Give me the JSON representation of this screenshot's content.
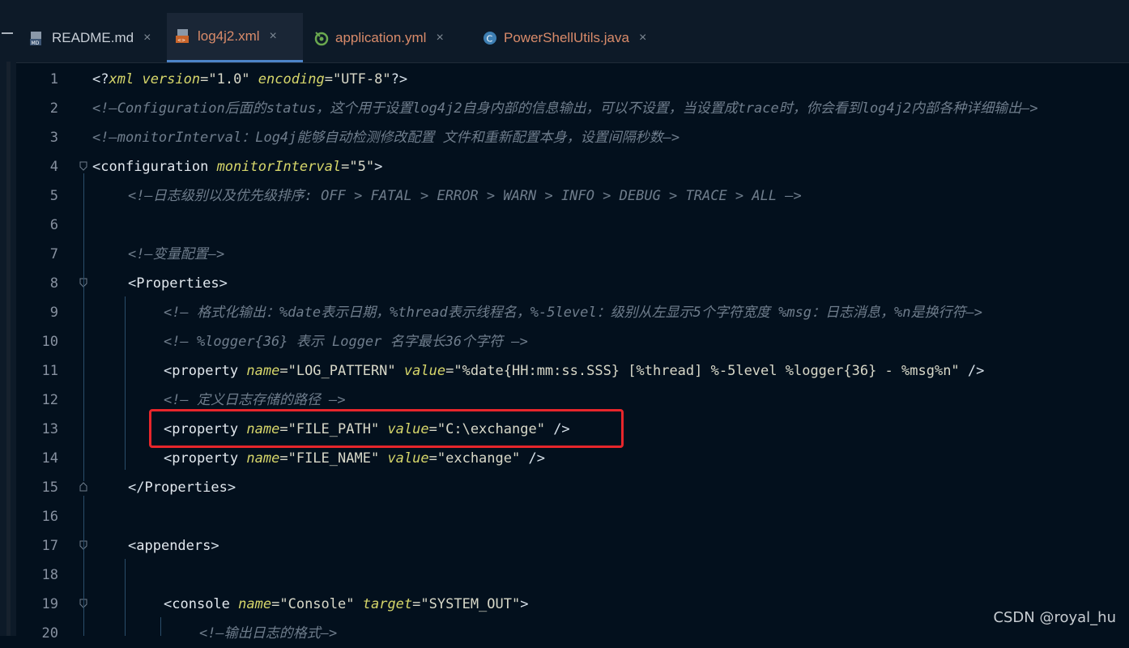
{
  "tabs": [
    {
      "label": "README.md",
      "icon": "markdown-file-icon",
      "active": false
    },
    {
      "label": "log4j2.xml",
      "icon": "xml-file-icon",
      "active": true
    },
    {
      "label": "application.yml",
      "icon": "yaml-file-icon",
      "active": false
    },
    {
      "label": "PowerShellUtils.java",
      "icon": "java-class-icon",
      "active": false
    }
  ],
  "tab_close_glyph": "×",
  "line_numbers": [
    "1",
    "2",
    "3",
    "4",
    "5",
    "6",
    "7",
    "8",
    "9",
    "10",
    "11",
    "12",
    "13",
    "14",
    "15",
    "16",
    "17",
    "18",
    "19",
    "20"
  ],
  "code": {
    "l1": {
      "open": "<?",
      "tag": "xml",
      "a1": "version",
      "v1": "\"1.0\"",
      "a2": "encoding",
      "v2": "\"UTF-8\"",
      "close": "?>"
    },
    "l2": "<!—Configuration后面的status，这个用于设置log4j2自身内部的信息输出，可以不设置，当设置成trace时，你会看到log4j2内部各种详细输出—>",
    "l3": "<!—monitorInterval：Log4j能够自动检测修改配置 文件和重新配置本身，设置间隔秒数—>",
    "l4": {
      "tag": "configuration",
      "a1": "monitorInterval",
      "v1": "\"5\""
    },
    "l5": "<!—日志级别以及优先级排序: OFF > FATAL > ERROR > WARN > INFO > DEBUG > TRACE > ALL —>",
    "l7": "<!—变量配置—>",
    "l8": {
      "tag": "Properties"
    },
    "l9": "<!— 格式化输出：%date表示日期，%thread表示线程名，%-5level：级别从左显示5个字符宽度 %msg：日志消息，%n是换行符—>",
    "l10": "<!— %logger{36} 表示 Logger 名字最长36个字符 —>",
    "l11": {
      "tag": "property",
      "a1": "name",
      "v1": "\"LOG_PATTERN\"",
      "a2": "value",
      "v2": "\"%date{HH:mm:ss.SSS} [%thread] %-5level %logger{36} - %msg%n\"",
      "close": "/>"
    },
    "l12": "<!— 定义日志存储的路径 —>",
    "l13": {
      "tag": "property",
      "a1": "name",
      "v1": "\"FILE_PATH\"",
      "a2": "value",
      "v2": "\"C:\\exchange\"",
      "close": "/>"
    },
    "l14": {
      "tag": "property",
      "a1": "name",
      "v1": "\"FILE_NAME\"",
      "a2": "value",
      "v2": "\"exchange\"",
      "close": "/>"
    },
    "l15": {
      "tag": "Properties"
    },
    "l17": {
      "tag": "appenders"
    },
    "l19": {
      "tag": "console",
      "a1": "name",
      "v1": "\"Console\"",
      "a2": "target",
      "v2": "\"SYSTEM_OUT\""
    },
    "l20": "<!—输出日志的格式—>"
  },
  "watermark": "CSDN @royal_hu",
  "colors": {
    "background": "#03101d",
    "highlight_border": "#e8262b",
    "active_tab_underline": "#4c84c8"
  }
}
